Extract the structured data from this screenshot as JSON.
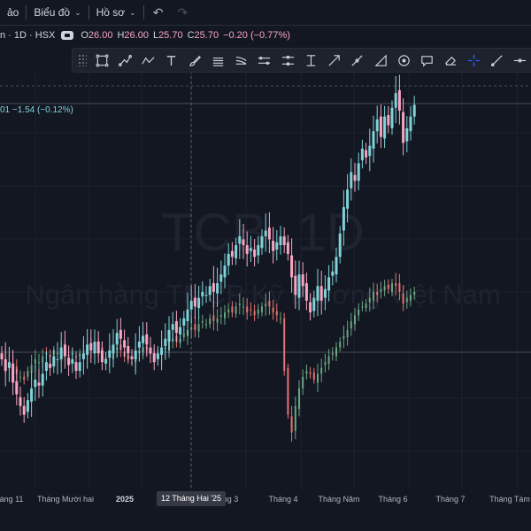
{
  "topbar": {
    "item_1": "ảo",
    "item_2": "Biểu đồ",
    "item_3": "Hồ sơ"
  },
  "legend": {
    "symbol": "n · 1D · HSX",
    "o_label": "O",
    "o_value": "26.00",
    "h_label": "H",
    "h_value": "26.00",
    "l_label": "L",
    "l_value": "25.70",
    "c_label": "C",
    "c_value": "25.70",
    "change": "−0.20 (−0.77%)"
  },
  "compare_legend": "01 −1.54 (−0.12%)",
  "watermark": {
    "title": "TCB, 1D",
    "company": "Ngân hàng TMCP Kỹ thương Việt Nam"
  },
  "toolbar": {
    "icons": [
      "rectangle-icon",
      "path-icon",
      "polyline-icon",
      "text-icon",
      "brush-icon",
      "parallel-channel-icon",
      "regression-channel-icon",
      "flat-channel-icon",
      "price-range-icon",
      "long-position-icon",
      "arrow-icon",
      "line-segment-icon",
      "triangle-icon",
      "circle-icon",
      "note-icon",
      "eraser-icon",
      "crosshair-icon",
      "ray-icon",
      "horizontal-ray-icon"
    ]
  },
  "x_axis": {
    "labels": [
      "áng 11",
      "Tháng Mười hai",
      "2025",
      "ằng 3",
      "Tháng 4",
      "Tháng Năm",
      "Tháng 6",
      "Tháng 7",
      "Tháng Tám"
    ],
    "crosshair_label": "12 Tháng Hai '25"
  },
  "colors": {
    "background": "#131722",
    "up": "#7fd3d8",
    "down": "#f7a5c1",
    "compare_up": "#6ba583",
    "compare_down": "#e57373",
    "grid": "#1c2030"
  },
  "chart_data": {
    "type": "candlestick",
    "title": "TCB, 1D",
    "subtitle": "Ngân hàng TMCP Kỹ thương Việt Nam",
    "last": {
      "open": 26.0,
      "high": 26.0,
      "low": 25.7,
      "close": 25.7,
      "change": -0.2,
      "change_pct": -0.77
    },
    "price_unit_note": "price axis not visible; candle closes in chart units",
    "x_tick_labels": [
      "áng 11",
      "Tháng Mười hai",
      "2025",
      "ằng 3",
      "Tháng 4",
      "Tháng Năm",
      "Tháng 6",
      "Tháng 7",
      "Tháng Tám"
    ],
    "price_closes": [
      22.0,
      21.6,
      21.9,
      21.2,
      20.8,
      20.4,
      20.1,
      20.6,
      21.0,
      21.3,
      21.1,
      21.5,
      21.9,
      21.7,
      22.1,
      22.0,
      22.4,
      22.1,
      21.8,
      22.0,
      21.6,
      21.9,
      22.2,
      22.5,
      22.3,
      22.6,
      22.2,
      21.9,
      22.0,
      22.3,
      22.5,
      22.9,
      22.7,
      22.4,
      22.2,
      22.0,
      22.3,
      22.6,
      22.8,
      22.5,
      22.2,
      21.9,
      22.2,
      22.4,
      22.7,
      23.0,
      23.2,
      22.9,
      23.1,
      23.4,
      23.7,
      24.0,
      23.8,
      24.1,
      24.3,
      24.2,
      24.5,
      24.3,
      24.6,
      24.9,
      25.2,
      25.6,
      25.5,
      25.9,
      26.2,
      25.9,
      25.6,
      25.8,
      25.5,
      25.9,
      26.2,
      26.4,
      26.1,
      25.7,
      26.0,
      26.2,
      25.9,
      25.6,
      24.8,
      24.2,
      24.9,
      24.5,
      24.0,
      23.6,
      24.1,
      24.5,
      24.0,
      24.4,
      24.8,
      25.0,
      25.5,
      26.3,
      27.2,
      27.8,
      28.4,
      28.1,
      28.7,
      29.2,
      28.9,
      29.3,
      29.8,
      30.2,
      29.6,
      30.3,
      30.0,
      30.6,
      31.1,
      30.5,
      29.4,
      29.9,
      30.3,
      30.7
    ],
    "compare_closes": [
      22.0,
      21.8,
      21.9,
      21.7,
      21.5,
      21.4,
      21.3,
      21.6,
      21.8,
      22.0,
      21.9,
      22.1,
      22.2,
      22.1,
      22.3,
      22.2,
      22.3,
      22.2,
      22.1,
      22.2,
      22.1,
      22.2,
      22.3,
      22.4,
      22.3,
      22.5,
      22.3,
      22.1,
      22.0,
      22.1,
      22.3,
      22.4,
      22.3,
      22.1,
      22.0,
      21.9,
      22.1,
      22.3,
      22.4,
      22.3,
      22.2,
      22.1,
      22.2,
      22.3,
      22.4,
      22.6,
      22.7,
      22.6,
      22.7,
      22.9,
      23.0,
      23.1,
      23.0,
      23.2,
      23.3,
      23.2,
      23.4,
      23.3,
      23.4,
      23.5,
      23.6,
      23.7,
      23.6,
      23.8,
      23.9,
      23.8,
      23.6,
      23.7,
      23.5,
      23.7,
      23.8,
      23.9,
      23.8,
      23.6,
      23.5,
      23.4,
      21.6,
      20.1,
      19.5,
      20.4,
      21.0,
      21.4,
      21.6,
      21.5,
      21.3,
      21.5,
      21.7,
      21.9,
      22.1,
      22.2,
      22.4,
      22.6,
      22.8,
      23.0,
      23.3,
      23.5,
      23.7,
      23.8,
      23.9,
      24.1,
      24.3,
      24.2,
      24.4,
      24.5,
      24.4,
      24.6,
      24.5,
      24.3,
      23.9,
      24.1,
      24.2,
      24.3
    ]
  }
}
